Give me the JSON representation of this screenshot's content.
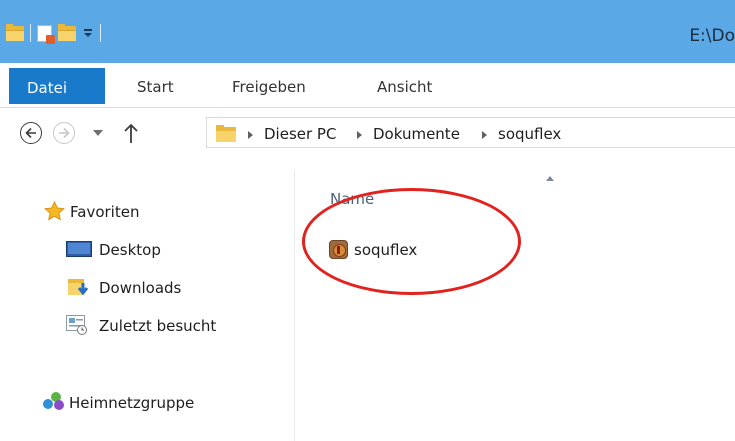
{
  "window": {
    "title": "E:\\Do"
  },
  "ribbon": {
    "tabs": [
      "Datei",
      "Start",
      "Freigeben",
      "Ansicht"
    ],
    "active_color": "#1979ca"
  },
  "address": {
    "crumbs": [
      "Dieser PC",
      "Dokumente",
      "soquflex"
    ]
  },
  "navpane": {
    "favorites": "Favoriten",
    "items": [
      "Desktop",
      "Downloads",
      "Zuletzt besucht"
    ],
    "homegroup": "Heimnetzgruppe"
  },
  "content": {
    "column_header": "Name",
    "files": [
      {
        "name": "soquflex",
        "icon": "application-icon"
      }
    ],
    "annotation_color": "#e2221e"
  },
  "icons": [
    "folder-icon",
    "properties-icon",
    "back-icon",
    "forward-icon",
    "up-icon",
    "star-icon",
    "desktop-icon",
    "downloads-icon",
    "recent-icon",
    "homegroup-icon"
  ]
}
